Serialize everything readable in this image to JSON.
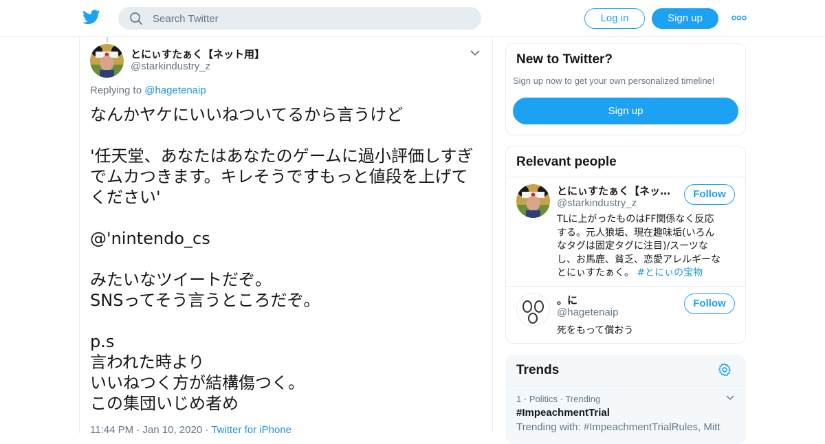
{
  "header": {
    "logo_icon": "twitter-bird-icon",
    "search_placeholder": "Search Twitter",
    "login_label": "Log in",
    "signup_label": "Sign up",
    "more_icon": "more-dots-icon",
    "accent_color": "#1da1f2"
  },
  "tweet": {
    "author_name": "とにぃすたぁく【ネット用】",
    "author_handle": "@starkindustry_z",
    "replying_prefix": "Replying to",
    "replying_to": "@hagetenaip",
    "lines": [
      "なんかヤケにいいねついてるから言うけど",
      "",
      "'任天堂、あなたはあなたのゲームに過小評価しすぎ",
      "でムカつきます。キレそうですもっと値段を上げて",
      "ください'",
      "",
      "@'nintendo_cs",
      "",
      "みたいなツイートだぞ。",
      "SNSってそう言うところだぞ。",
      "",
      "p.s",
      "言われた時より",
      "いいねつく方が結構傷つく。",
      "この集団いじめ者め"
    ],
    "time": "11:44 PM",
    "date": "Jan 10, 2020",
    "source": "Twitter for iPhone"
  },
  "new_to_twitter": {
    "title": "New to Twitter?",
    "subtitle": "Sign up now to get your own personalized timeline!",
    "signup_label": "Sign up"
  },
  "relevant_people": {
    "title": "Relevant people",
    "people": [
      {
        "name": "とにぃすたぁく【ネット用】",
        "handle": "@starkindustry_z",
        "follow_label": "Follow",
        "bio_lines": [
          "TLに上がったものはFF関係なく反応",
          "する。元人狼垢、現在趣味垢(いろん",
          "なタグは固定タグに注目)/スーツな",
          "し、お馬鹿、貧乏、恋愛アレルギーな"
        ],
        "bio_last": "とにぃすたぁく。",
        "bio_tag": "#とにぃの宝物"
      },
      {
        "name": "。に",
        "handle": "@hagetenaip",
        "follow_label": "Follow",
        "bio": "死をもって償おう"
      }
    ]
  },
  "trends": {
    "title": "Trends",
    "items": [
      {
        "rank": "1",
        "category": "Politics",
        "status": "Trending",
        "name": "#ImpeachmentTrial",
        "with": "Trending with: #ImpeachmentTrialRules, Mitt"
      }
    ]
  }
}
